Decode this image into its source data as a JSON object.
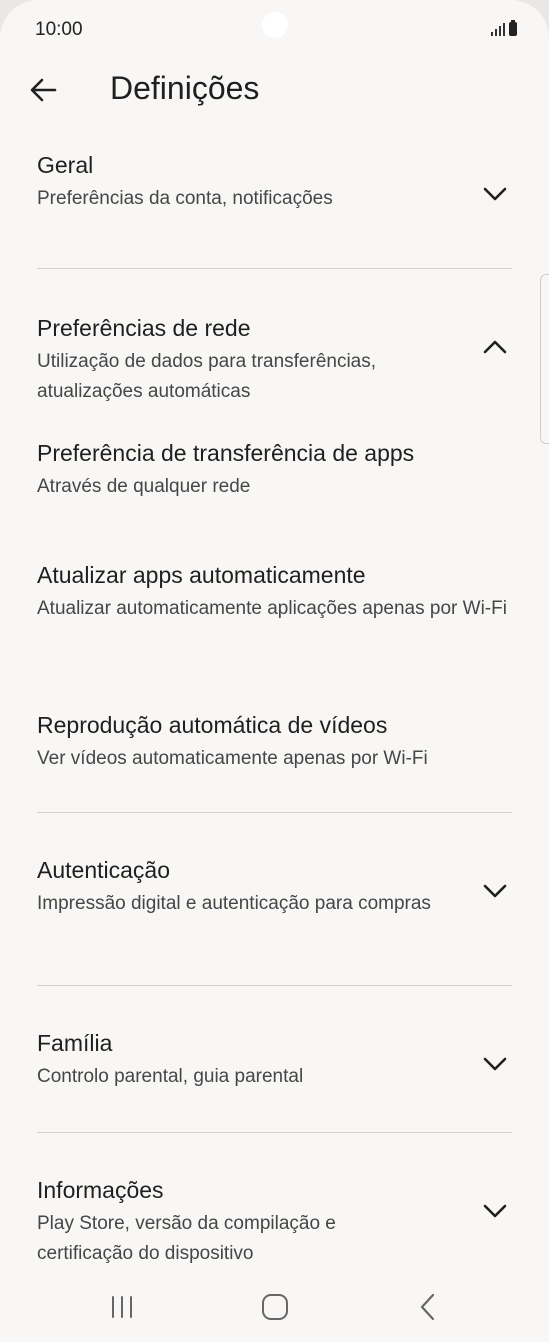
{
  "status": {
    "time": "10:00"
  },
  "header": {
    "title": "Definições"
  },
  "sections": {
    "geral": {
      "title": "Geral",
      "subtitle": "Preferências da conta, notificações"
    },
    "rede": {
      "title": "Preferências de rede",
      "subtitle": "Utilização de dados para transferências, atualizações automáticas"
    },
    "transferencia": {
      "title": "Preferência de transferência de apps",
      "subtitle": "Através de qualquer rede"
    },
    "atualizar": {
      "title": "Atualizar apps automaticamente",
      "subtitle": "Atualizar automaticamente aplicações apenas por Wi-Fi"
    },
    "videos": {
      "title": "Reprodução automática de vídeos",
      "subtitle": "Ver vídeos automaticamente apenas por Wi-Fi"
    },
    "autenticacao": {
      "title": "Autenticação",
      "subtitle": "Impressão digital e autenticação para compras"
    },
    "familia": {
      "title": "Família",
      "subtitle": "Controlo parental, guia parental"
    },
    "informacoes": {
      "title": "Informações",
      "subtitle": "Play Store, versão da compilação e certificação do dispositivo"
    }
  },
  "icons": {
    "back": "arrow-left-icon",
    "expand": "chevron-down-icon",
    "collapse": "chevron-up-icon",
    "nav_recents": "recents-icon",
    "nav_home": "home-icon",
    "nav_back": "nav-back-icon"
  }
}
